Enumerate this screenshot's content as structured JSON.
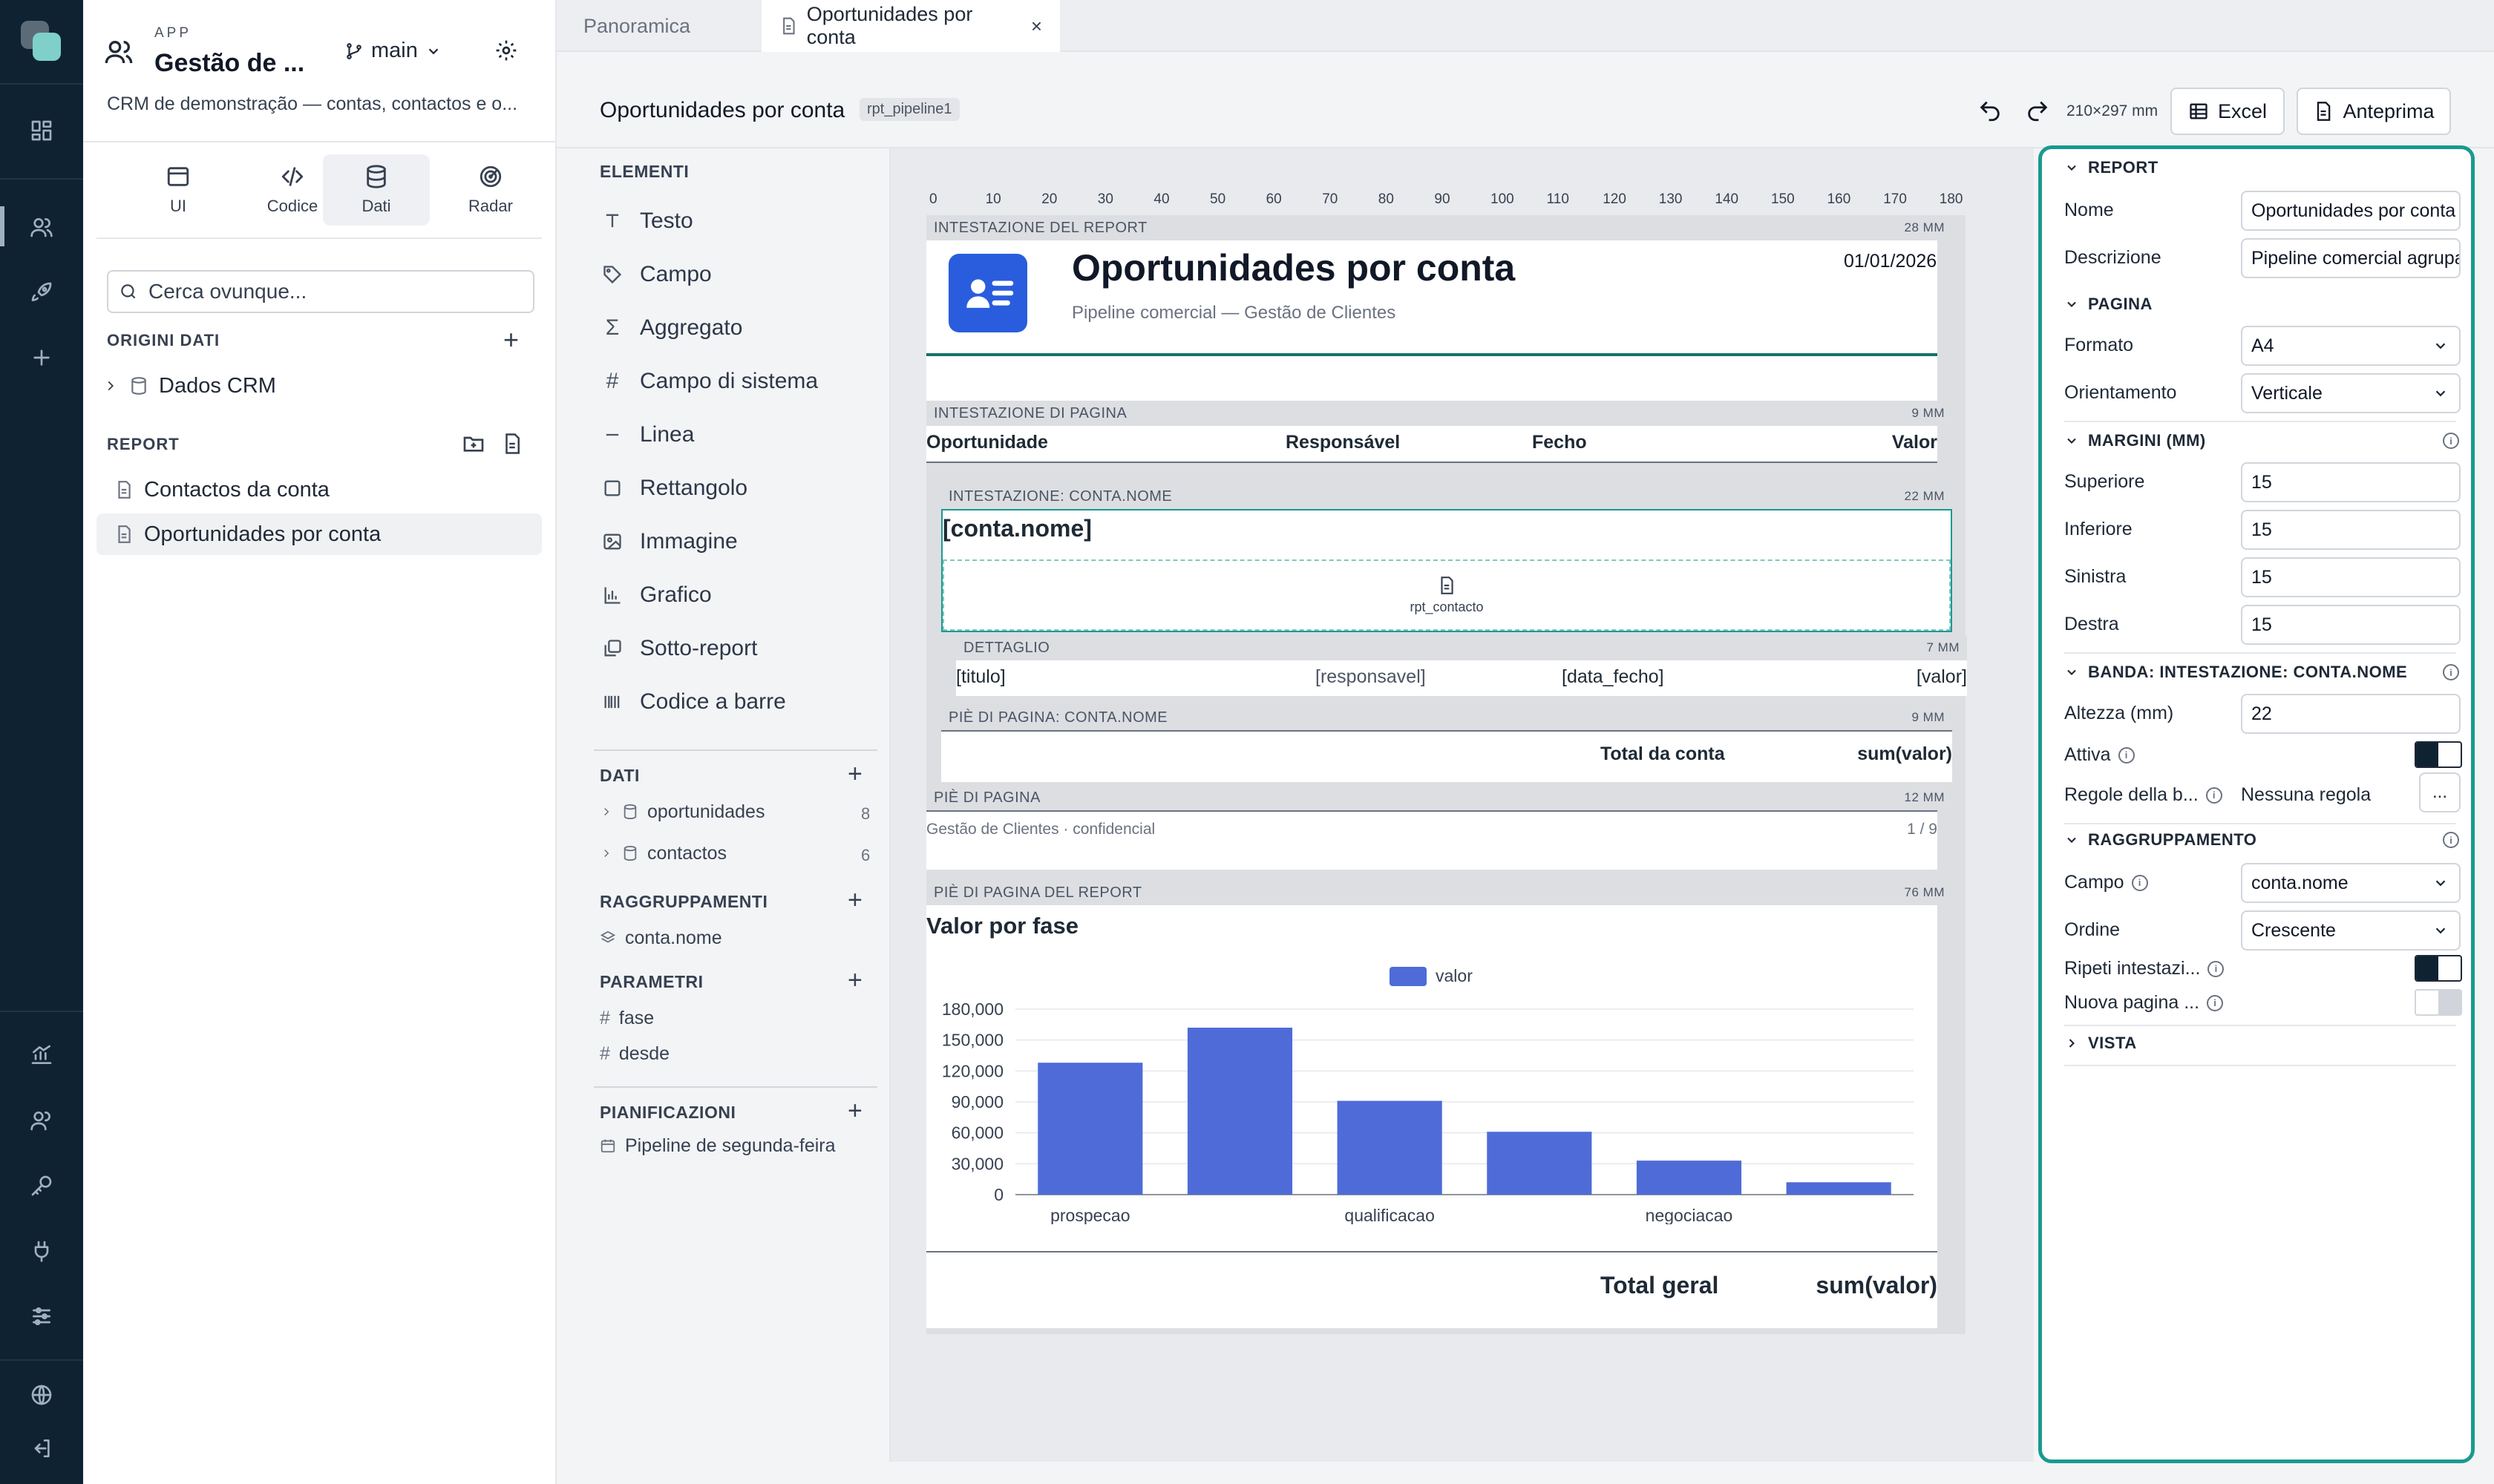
{
  "app": {
    "label": "APP",
    "name": "Gestão de ...",
    "branch": "main",
    "description": "CRM de demonstração — contas, contactos e o..."
  },
  "sidebar": {
    "tabs": [
      {
        "label": "UI"
      },
      {
        "label": "Codice"
      },
      {
        "label": "Dati"
      },
      {
        "label": "Radar"
      }
    ],
    "active_tab": "Dati",
    "search_placeholder": "Cerca ovunque...",
    "data_sources_title": "ORIGINI DATI",
    "data_sources": [
      {
        "label": "Dados CRM"
      }
    ],
    "reports_title": "REPORT",
    "reports": [
      {
        "label": "Contactos da conta"
      },
      {
        "label": "Oportunidades por conta"
      }
    ]
  },
  "tabs": [
    {
      "label": "Panoramica"
    },
    {
      "label": "Oportunidades por conta"
    }
  ],
  "toolbar": {
    "title": "Oportunidades por conta",
    "badge": "rpt_pipeline1",
    "page_size": "210×297 mm",
    "excel_label": "Excel",
    "preview_label": "Anteprima"
  },
  "elements": {
    "title": "ELEMENTI",
    "items": [
      {
        "label": "Testo",
        "icon": "text-icon"
      },
      {
        "label": "Campo",
        "icon": "tag-icon"
      },
      {
        "label": "Aggregato",
        "icon": "sigma-icon"
      },
      {
        "label": "Campo di sistema",
        "icon": "hash-icon"
      },
      {
        "label": "Linea",
        "icon": "line-icon"
      },
      {
        "label": "Rettangolo",
        "icon": "square-icon"
      },
      {
        "label": "Immagine",
        "icon": "image-icon"
      },
      {
        "label": "Grafico",
        "icon": "chart-icon"
      },
      {
        "label": "Sotto-report",
        "icon": "subreport-icon"
      },
      {
        "label": "Codice a barre",
        "icon": "barcode-icon"
      }
    ],
    "data_title": "DATI",
    "data": [
      {
        "label": "oportunidades",
        "count": "8"
      },
      {
        "label": "contactos",
        "count": "6"
      }
    ],
    "groupings_title": "RAGGRUPPAMENTI",
    "groupings": [
      {
        "label": "conta.nome"
      }
    ],
    "params_title": "PARAMETRI",
    "params": [
      {
        "label": "fase"
      },
      {
        "label": "desde"
      }
    ],
    "schedules_title": "PIANIFICAZIONI",
    "schedules": [
      {
        "label": "Pipeline de segunda-feira"
      }
    ]
  },
  "ruler": [
    "0",
    "10",
    "20",
    "30",
    "40",
    "50",
    "60",
    "70",
    "80",
    "90",
    "100",
    "110",
    "120",
    "130",
    "140",
    "150",
    "160",
    "170",
    "180"
  ],
  "report": {
    "header_band": {
      "label": "INTESTAZIONE DEL REPORT",
      "mm": "28 MM"
    },
    "title": "Oportunidades por conta",
    "subtitle": "Pipeline comercial — Gestão de Clientes",
    "date": "01/01/2026",
    "page_header_band": {
      "label": "INTESTAZIONE DI PAGINA",
      "mm": "9 MM"
    },
    "columns": [
      "Oportunidade",
      "Responsável",
      "Fecho",
      "Valor"
    ],
    "group_header_band": {
      "label": "INTESTAZIONE: CONTA.NOME",
      "mm": "22 MM"
    },
    "group_field": "[conta.nome]",
    "subreport": "rpt_contacto",
    "detail_band": {
      "label": "DETTAGLIO",
      "mm": "7 MM"
    },
    "detail_fields": [
      "[titulo]",
      "[responsavel]",
      "[data_fecho]",
      "[valor]"
    ],
    "group_footer_band": {
      "label": "PIÈ DI PAGINA: CONTA.NOME",
      "mm": "9 MM"
    },
    "group_total_label": "Total da conta",
    "group_total_value": "sum(valor)",
    "page_footer_band": {
      "label": "PIÈ DI PAGINA",
      "mm": "12 MM"
    },
    "footer_text": "Gestão de Clientes · confidencial",
    "page_number": "1 / 9",
    "report_footer_band": {
      "label": "PIÈ DI PAGINA DEL REPORT",
      "mm": "76 MM"
    },
    "grand_total_label": "Total geral",
    "grand_total_value": "sum(valor)"
  },
  "chart_data": {
    "type": "bar",
    "title": "Valor por fase",
    "categories": [
      "prospecao",
      "",
      "qualificacao",
      "",
      "negociacao",
      ""
    ],
    "series": [
      {
        "name": "valor",
        "values": [
          128000,
          162000,
          91000,
          61000,
          33000,
          12000
        ]
      }
    ],
    "ylim": [
      0,
      180000
    ],
    "yticks": [
      "0",
      "30,000",
      "60,000",
      "90,000",
      "120,000",
      "150,000",
      "180,000"
    ],
    "xlabel": "",
    "ylabel": "",
    "legend": "top",
    "color": "#4f6bd8"
  },
  "props": {
    "report_title": "REPORT",
    "name_label": "Nome",
    "name_value": "Oportunidades por conta",
    "desc_label": "Descrizione",
    "desc_value": "Pipeline comercial agrupado",
    "page_title": "PAGINA",
    "format_label": "Formato",
    "format_value": "A4",
    "orient_label": "Orientamento",
    "orient_value": "Verticale",
    "margins_title": "MARGINI (MM)",
    "top_label": "Superiore",
    "top_value": "15",
    "bottom_label": "Inferiore",
    "bottom_value": "15",
    "left_label": "Sinistra",
    "left_value": "15",
    "right_label": "Destra",
    "right_value": "15",
    "band_title": "BANDA: INTESTAZIONE: CONTA.NOME",
    "height_label": "Altezza (mm)",
    "height_value": "22",
    "active_label": "Attiva",
    "rules_label": "Regole della b...",
    "rules_value": "Nessuna regola",
    "rules_btn": "...",
    "grouping_title": "RAGGRUPPAMENTO",
    "field_label": "Campo",
    "field_value": "conta.nome",
    "order_label": "Ordine",
    "order_value": "Crescente",
    "repeat_label": "Ripeti intestazi...",
    "newpage_label": "Nuova pagina ...",
    "view_title": "VISTA"
  }
}
